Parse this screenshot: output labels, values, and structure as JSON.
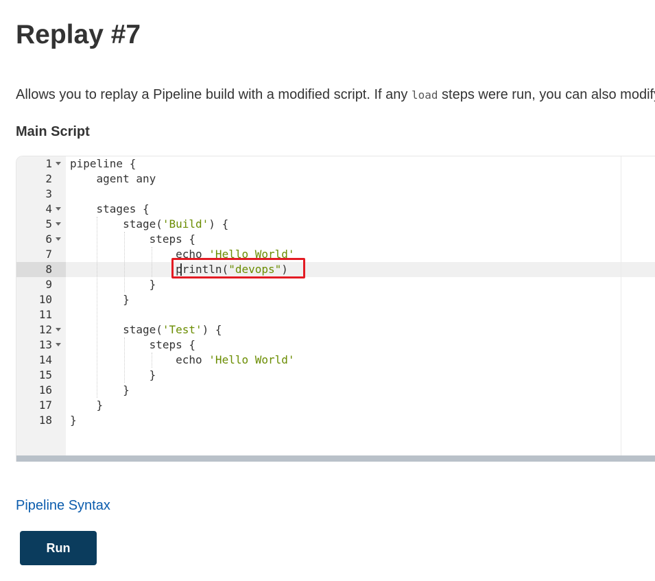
{
  "page": {
    "title": "Replay #7",
    "description_before": "Allows you to replay a Pipeline build with a modified script. If any ",
    "description_code": "load",
    "description_after": " steps were run, you can also modify their scripts.",
    "section_title": "Main Script"
  },
  "editor": {
    "active_line": 8,
    "lines": [
      {
        "n": "1",
        "fold": true,
        "segments": [
          {
            "t": "pipeline {",
            "s": ""
          }
        ]
      },
      {
        "n": "2",
        "fold": false,
        "segments": [
          {
            "t": "    agent any",
            "s": ""
          }
        ]
      },
      {
        "n": "3",
        "fold": false,
        "segments": [
          {
            "t": "",
            "s": ""
          }
        ]
      },
      {
        "n": "4",
        "fold": true,
        "segments": [
          {
            "t": "    stages {",
            "s": ""
          }
        ]
      },
      {
        "n": "5",
        "fold": true,
        "segments": [
          {
            "t": "        stage(",
            "s": ""
          },
          {
            "t": "'Build'",
            "s": "str"
          },
          {
            "t": ") {",
            "s": ""
          }
        ]
      },
      {
        "n": "6",
        "fold": true,
        "segments": [
          {
            "t": "            steps {",
            "s": ""
          }
        ]
      },
      {
        "n": "7",
        "fold": false,
        "segments": [
          {
            "t": "                echo ",
            "s": ""
          },
          {
            "t": "'Hello World'",
            "s": "str"
          }
        ]
      },
      {
        "n": "8",
        "fold": false,
        "segments": [
          {
            "t": "                println(",
            "s": ""
          },
          {
            "t": "\"devops\"",
            "s": "str"
          },
          {
            "t": ")",
            "s": ""
          }
        ]
      },
      {
        "n": "9",
        "fold": false,
        "segments": [
          {
            "t": "            }",
            "s": ""
          }
        ]
      },
      {
        "n": "10",
        "fold": false,
        "segments": [
          {
            "t": "        }",
            "s": ""
          }
        ]
      },
      {
        "n": "11",
        "fold": false,
        "segments": [
          {
            "t": "",
            "s": ""
          }
        ]
      },
      {
        "n": "12",
        "fold": true,
        "segments": [
          {
            "t": "        stage(",
            "s": ""
          },
          {
            "t": "'Test'",
            "s": "str"
          },
          {
            "t": ") {",
            "s": ""
          }
        ]
      },
      {
        "n": "13",
        "fold": true,
        "segments": [
          {
            "t": "            steps {",
            "s": ""
          }
        ]
      },
      {
        "n": "14",
        "fold": false,
        "segments": [
          {
            "t": "                echo ",
            "s": ""
          },
          {
            "t": "'Hello World'",
            "s": "str"
          }
        ]
      },
      {
        "n": "15",
        "fold": false,
        "segments": [
          {
            "t": "            }",
            "s": ""
          }
        ]
      },
      {
        "n": "16",
        "fold": false,
        "segments": [
          {
            "t": "        }",
            "s": ""
          }
        ]
      },
      {
        "n": "17",
        "fold": false,
        "segments": [
          {
            "t": "    }",
            "s": ""
          }
        ]
      },
      {
        "n": "18",
        "fold": false,
        "segments": [
          {
            "t": "}",
            "s": ""
          }
        ]
      }
    ]
  },
  "links": {
    "pipeline_syntax": "Pipeline Syntax"
  },
  "actions": {
    "run_label": "Run"
  },
  "colors": {
    "accent": "#0b3c5d",
    "link": "#0b5cad",
    "string": "#6a8c00",
    "highlight_box": "#e31b23"
  }
}
